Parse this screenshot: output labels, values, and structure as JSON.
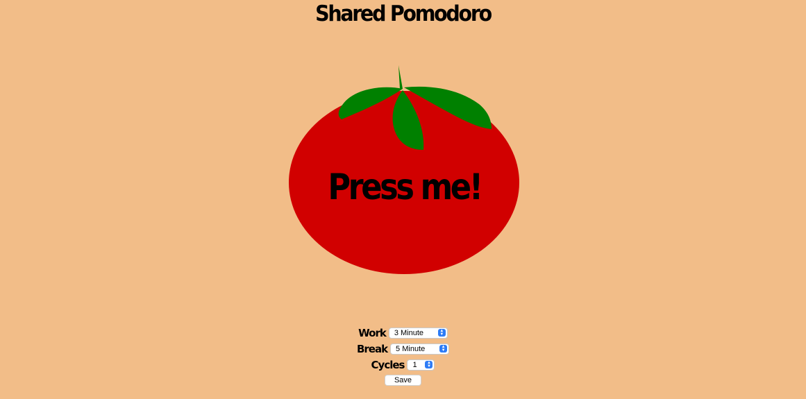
{
  "header": {
    "title": "Shared Pomodoro"
  },
  "tomato": {
    "label": "Press me!",
    "body_color": "#d10000",
    "leaf_color": "#008000"
  },
  "settings": {
    "work_label": "Work",
    "work_value": "3 Minute",
    "break_label": "Break",
    "break_value": "5 Minute",
    "cycles_label": "Cycles",
    "cycles_value": "1",
    "save_label": "Save"
  },
  "colors": {
    "background": "#f2bd88",
    "select_accent": "#2e7cf6"
  }
}
